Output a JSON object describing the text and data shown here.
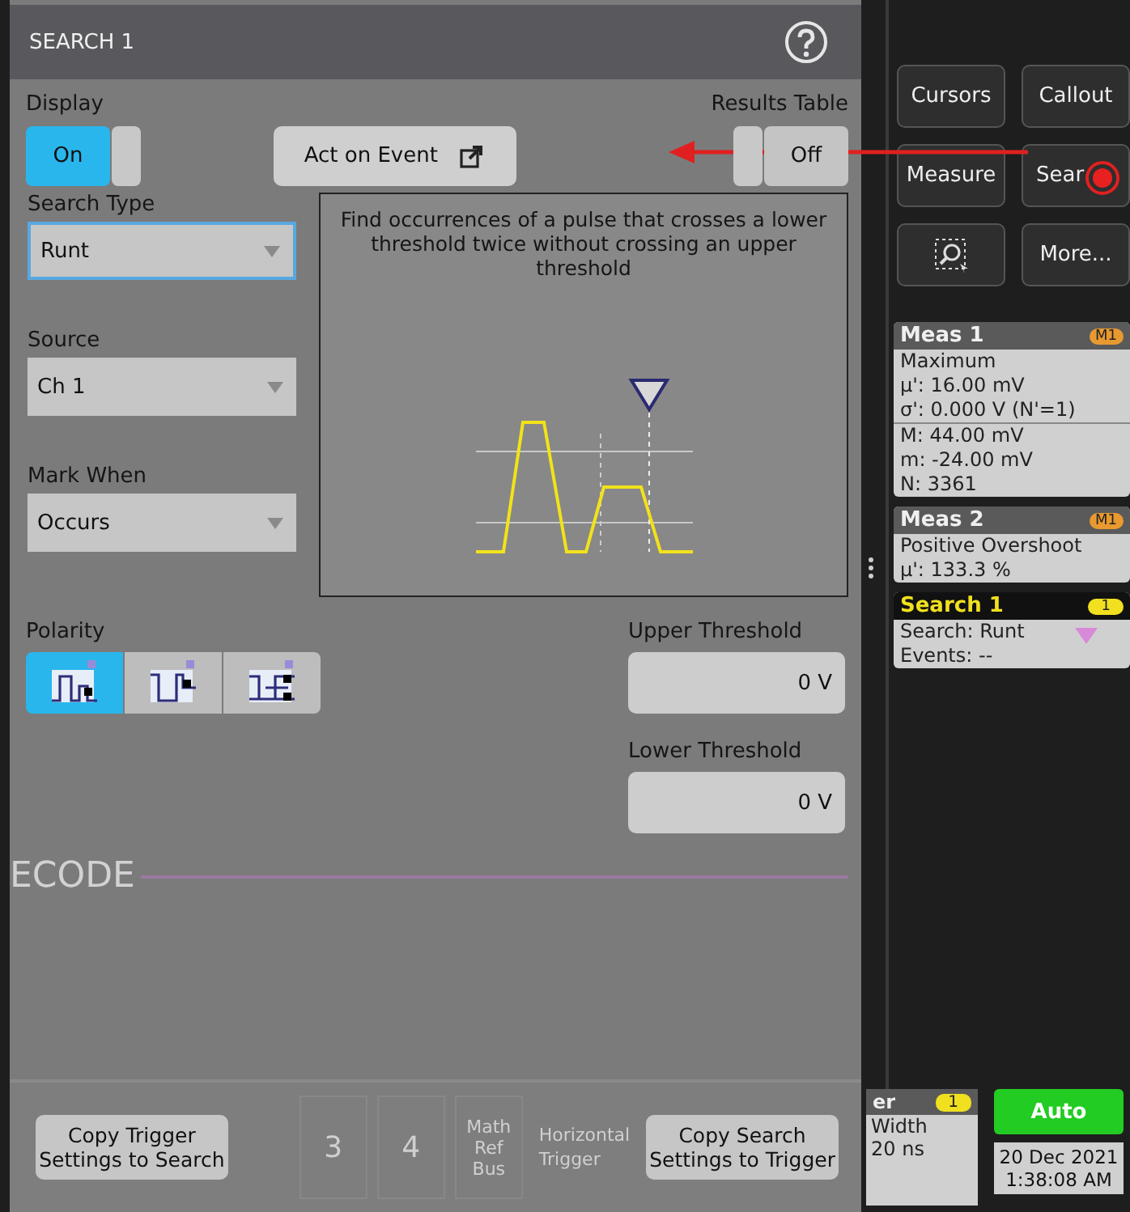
{
  "panel": {
    "title": "SEARCH 1",
    "display": {
      "label": "Display",
      "value": "On",
      "on": true
    },
    "act_button": {
      "label": "Act on Event"
    },
    "results_table": {
      "label": "Results Table",
      "value": "Off",
      "on": false
    },
    "dropdowns": [
      {
        "label": "Search Type",
        "value": "Runt",
        "focused": true
      },
      {
        "label": "Source",
        "value": "Ch 1",
        "focused": false
      },
      {
        "label": "Mark When",
        "value": "Occurs",
        "focused": false
      }
    ],
    "description": "Find occurrences of a pulse that crosses a lower threshold twice without crossing an upper threshold",
    "polarity": {
      "label": "Polarity",
      "options": [
        {
          "kind": "positive",
          "selected": true
        },
        {
          "kind": "negative",
          "selected": false
        },
        {
          "kind": "either",
          "selected": false
        }
      ]
    },
    "thresholds": [
      {
        "label": "Upper Threshold",
        "value": "0 V"
      },
      {
        "label": "Lower Threshold",
        "value": "0 V"
      }
    ],
    "background_label": "ECODE",
    "background_tiles": [
      [
        "3"
      ],
      [
        "4"
      ],
      [
        "Math",
        "Ref",
        "Bus"
      ]
    ],
    "background_headers": [
      "Horizontal",
      "Trigger"
    ],
    "bottom_buttons": [
      "Copy Trigger Settings to Search",
      "Copy Search Settings to Trigger"
    ]
  },
  "sidebar": {
    "buttons": [
      {
        "kind": "text",
        "label": "Cursors"
      },
      {
        "kind": "text",
        "label": "Callout"
      },
      {
        "kind": "text",
        "label": "Measure"
      },
      {
        "kind": "text",
        "label": "Sear"
      },
      {
        "kind": "zoom"
      },
      {
        "kind": "text",
        "label": "More..."
      }
    ],
    "cards": [
      {
        "kind": "measurement",
        "title": "Meas 1",
        "badge": "M1",
        "sections": [
          [
            "Maximum",
            "μ': 16.00 mV",
            "σ': 0.000 V (N'=1)"
          ],
          [
            "M: 44.00 mV",
            "m: -24.00 mV",
            "N: 3361"
          ]
        ]
      },
      {
        "kind": "measurement",
        "title": "Meas 2",
        "badge": "M1",
        "sections": [
          [
            "Positive Overshoot",
            "μ': 133.3 %"
          ]
        ]
      },
      {
        "kind": "search",
        "title": "Search 1",
        "badge": "1",
        "sections": [
          [
            "Search: Runt",
            "Events: --"
          ]
        ]
      }
    ],
    "trigger": {
      "title": "er",
      "badge": "1",
      "lines": [
        "Width",
        "20 ns"
      ]
    },
    "auto_button": "Auto",
    "date": [
      "20 Dec 2021",
      "1:38:08 AM"
    ]
  }
}
